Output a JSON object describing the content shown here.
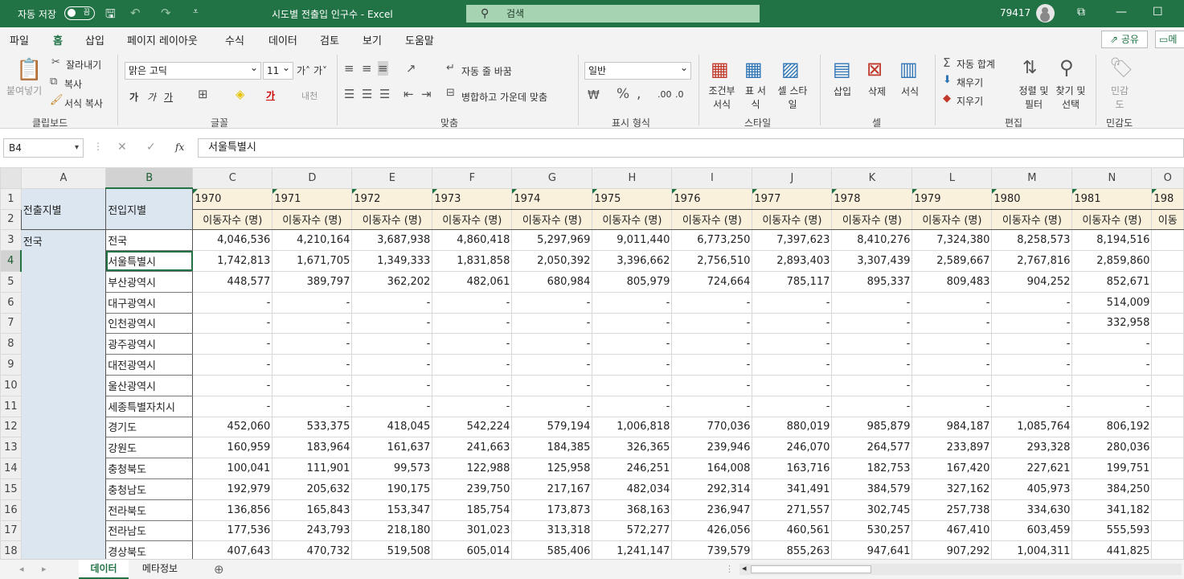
{
  "titlebar": {
    "autosave_label": "자동 저장",
    "autosave_state": "끔",
    "doc_title": "시도별 전출입 인구수  -  Excel",
    "search_placeholder": "검색",
    "user": "79417"
  },
  "menu": {
    "items": [
      "파일",
      "홈",
      "삽입",
      "페이지 레이아웃",
      "수식",
      "데이터",
      "검토",
      "보기",
      "도움말"
    ],
    "active": "홈",
    "share_label": "공유",
    "memo_label": "메"
  },
  "ribbon": {
    "clipboard": {
      "paste": "붙여넣기",
      "cut": "잘라내기",
      "copy": "복사",
      "format_painter": "서식 복사",
      "label": "클립보드"
    },
    "font": {
      "font_name": "맑은 고딕",
      "font_size": "11",
      "label": "글꼴"
    },
    "align": {
      "wrap": "자동 줄 바꿈",
      "merge": "병합하고 가운데 맞춤",
      "label": "맞춤"
    },
    "number": {
      "format": "일반",
      "label": "표시 형식"
    },
    "style": {
      "conditional": "조건부 서식",
      "table": "표 서식",
      "cell_style": "셀 스타일",
      "label": "스타일"
    },
    "cells": {
      "insert": "삽입",
      "delete": "삭제",
      "format": "서식",
      "label": "셀"
    },
    "edit": {
      "autosum": "자동 합계",
      "fill": "채우기",
      "clear": "지우기",
      "sort": "정렬 및 필터",
      "find": "찾기 및 선택",
      "label": "편집"
    },
    "sensitivity": {
      "btn": "민감도",
      "label": "민감도"
    }
  },
  "formula": {
    "cell_ref": "B4",
    "content": "서울특별시"
  },
  "sheet": {
    "columns": [
      "A",
      "B",
      "C",
      "D",
      "E",
      "F",
      "G",
      "H",
      "I",
      "J",
      "K",
      "L",
      "M",
      "N",
      "O"
    ],
    "header_A": "전출지별",
    "header_B": "전입지별",
    "years": [
      "1970",
      "1971",
      "1972",
      "1973",
      "1974",
      "1975",
      "1976",
      "1977",
      "1978",
      "1979",
      "1980",
      "1981",
      "198"
    ],
    "unit_label": "이동자수 (명)",
    "unit_partial": "이동",
    "origin": "전국",
    "rows": [
      {
        "r": "3",
        "name": "전국",
        "v": [
          "4,046,536",
          "4,210,164",
          "3,687,938",
          "4,860,418",
          "5,297,969",
          "9,011,440",
          "6,773,250",
          "7,397,623",
          "8,410,276",
          "7,324,380",
          "8,258,573",
          "8,194,516"
        ]
      },
      {
        "r": "4",
        "name": "서울특별시",
        "v": [
          "1,742,813",
          "1,671,705",
          "1,349,333",
          "1,831,858",
          "2,050,392",
          "3,396,662",
          "2,756,510",
          "2,893,403",
          "3,307,439",
          "2,589,667",
          "2,767,816",
          "2,859,860"
        ]
      },
      {
        "r": "5",
        "name": "부산광역시",
        "v": [
          "448,577",
          "389,797",
          "362,202",
          "482,061",
          "680,984",
          "805,979",
          "724,664",
          "785,117",
          "895,337",
          "809,483",
          "904,252",
          "852,671"
        ]
      },
      {
        "r": "6",
        "name": "대구광역시",
        "v": [
          "-",
          "-",
          "-",
          "-",
          "-",
          "-",
          "-",
          "-",
          "-",
          "-",
          "-",
          "514,009"
        ]
      },
      {
        "r": "7",
        "name": "인천광역시",
        "v": [
          "-",
          "-",
          "-",
          "-",
          "-",
          "-",
          "-",
          "-",
          "-",
          "-",
          "-",
          "332,958"
        ]
      },
      {
        "r": "8",
        "name": "광주광역시",
        "v": [
          "-",
          "-",
          "-",
          "-",
          "-",
          "-",
          "-",
          "-",
          "-",
          "-",
          "-",
          "-"
        ]
      },
      {
        "r": "9",
        "name": "대전광역시",
        "v": [
          "-",
          "-",
          "-",
          "-",
          "-",
          "-",
          "-",
          "-",
          "-",
          "-",
          "-",
          "-"
        ]
      },
      {
        "r": "10",
        "name": "울산광역시",
        "v": [
          "-",
          "-",
          "-",
          "-",
          "-",
          "-",
          "-",
          "-",
          "-",
          "-",
          "-",
          "-"
        ]
      },
      {
        "r": "11",
        "name": "세종특별자치시",
        "v": [
          "-",
          "-",
          "-",
          "-",
          "-",
          "-",
          "-",
          "-",
          "-",
          "-",
          "-",
          "-"
        ]
      },
      {
        "r": "12",
        "name": "경기도",
        "v": [
          "452,060",
          "533,375",
          "418,045",
          "542,224",
          "579,194",
          "1,006,818",
          "770,036",
          "880,019",
          "985,879",
          "984,187",
          "1,085,764",
          "806,192"
        ]
      },
      {
        "r": "13",
        "name": "강원도",
        "v": [
          "160,959",
          "183,964",
          "161,637",
          "241,663",
          "184,385",
          "326,365",
          "239,946",
          "246,070",
          "264,577",
          "233,897",
          "293,328",
          "280,036"
        ]
      },
      {
        "r": "14",
        "name": "충청북도",
        "v": [
          "100,041",
          "111,901",
          "99,573",
          "122,988",
          "125,958",
          "246,251",
          "164,008",
          "163,716",
          "182,753",
          "167,420",
          "227,621",
          "199,751"
        ]
      },
      {
        "r": "15",
        "name": "충청남도",
        "v": [
          "192,979",
          "205,632",
          "190,175",
          "239,750",
          "217,167",
          "482,034",
          "292,314",
          "341,491",
          "384,579",
          "327,162",
          "405,973",
          "384,250"
        ]
      },
      {
        "r": "16",
        "name": "전라북도",
        "v": [
          "136,856",
          "165,843",
          "153,347",
          "185,754",
          "173,873",
          "368,163",
          "236,947",
          "271,557",
          "302,745",
          "257,738",
          "334,630",
          "341,182"
        ]
      },
      {
        "r": "17",
        "name": "전라남도",
        "v": [
          "177,536",
          "243,793",
          "218,180",
          "301,023",
          "313,318",
          "572,277",
          "426,056",
          "460,561",
          "530,257",
          "467,410",
          "603,459",
          "555,593"
        ]
      },
      {
        "r": "18",
        "name": "경상북도",
        "v": [
          "407,643",
          "470,732",
          "519,508",
          "605,014",
          "585,406",
          "1,241,147",
          "739,579",
          "855,263",
          "947,641",
          "907,292",
          "1,004,311",
          "441,825"
        ]
      }
    ]
  },
  "sheet_tabs": [
    "데이터",
    "메타정보"
  ],
  "active_tab": "데이터"
}
